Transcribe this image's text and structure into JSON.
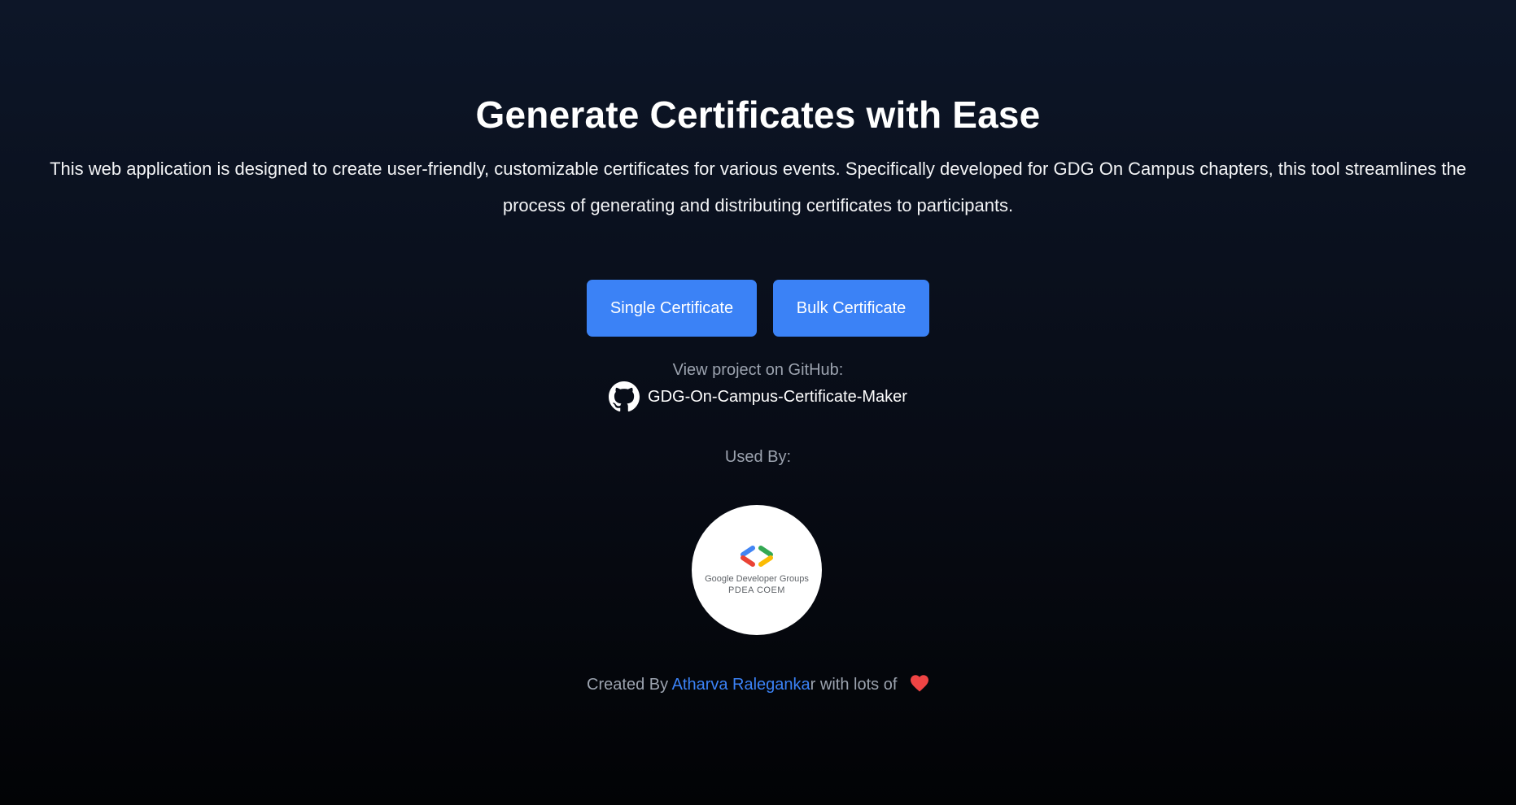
{
  "hero": {
    "title": "Generate Certificates with Ease",
    "description": "This web application is designed to create user-friendly, customizable certificates for various events. Specifically developed for GDG On Campus chapters, this tool streamlines the process of generating and distributing certificates to participants."
  },
  "actions": {
    "single_label": "Single Certificate",
    "bulk_label": "Bulk Certificate"
  },
  "github": {
    "label": "View project on GitHub:",
    "repo_name": "GDG-On-Campus-Certificate-Maker",
    "icon": "github-icon"
  },
  "used_by": {
    "label": "Used By:",
    "logo": {
      "line1": "Google Developer Groups",
      "line2": "PDEA COEM",
      "icon": "gdg-logo-icon"
    }
  },
  "footer": {
    "prefix": "Created By",
    "author": "Atharva Raleganka",
    "author_full": "Atharva Raleganka",
    "suffix": "with lots of",
    "icon": "heart-icon"
  },
  "colors": {
    "accent": "#3b82f6",
    "heart": "#ef4444",
    "muted_text": "#9ca3af"
  }
}
